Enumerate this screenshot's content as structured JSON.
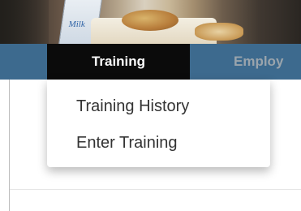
{
  "banner": {
    "carton_text": "Milk"
  },
  "nav": {
    "tabs": [
      {
        "label": "Training",
        "active": true
      },
      {
        "label": "Employ",
        "active": false
      }
    ],
    "colors": {
      "bar": "#3d6a8e",
      "active_tab": "#0b0b0b",
      "active_text": "#ffffff",
      "inactive_text": "#9aa4ac"
    }
  },
  "dropdown": {
    "items": [
      {
        "label": "Training History"
      },
      {
        "label": "Enter Training"
      }
    ]
  }
}
